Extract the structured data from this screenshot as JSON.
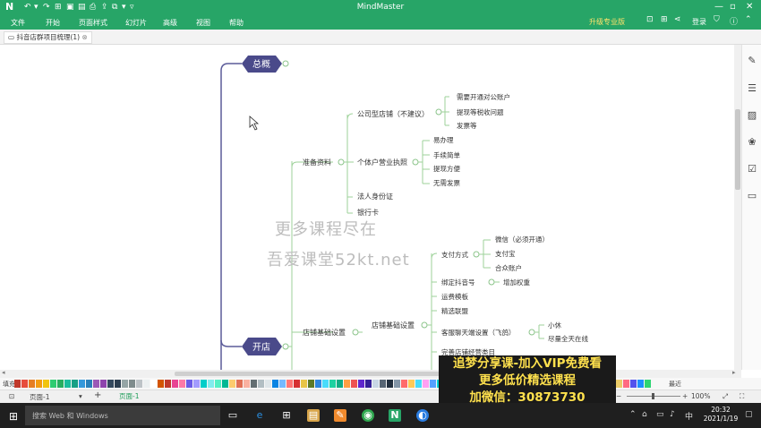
{
  "app": {
    "title": "MindMaster",
    "logo_glyph": "N",
    "pro_badge": "升级专业版",
    "login": "登录"
  },
  "menu": [
    "文件",
    "开始",
    "页面样式",
    "幻灯片",
    "高级",
    "视图",
    "帮助"
  ],
  "tabs": {
    "doc": "抖音店群项目梳理(1)",
    "close": "⊗"
  },
  "mindmap": {
    "topics": {
      "overview": "总概",
      "open": "开店"
    },
    "branch_prep": {
      "label": "准备资料",
      "company": "公司型店铺（不建议）",
      "company_children": [
        "需要开通对公账户",
        "提现等税收问题",
        "发票等"
      ],
      "individual": "个体户营业执照",
      "individual_children": [
        "易办理",
        "手续简单",
        "提现方便",
        "无需发票"
      ],
      "id_card": "法人身份证",
      "bank_card": "银行卡"
    },
    "branch_shop": {
      "label": "店铺基础设置",
      "sub": "店铺基础设置",
      "payment": "支付方式",
      "payment_children": [
        "微信（必须开通）",
        "支付宝",
        "合众账户"
      ],
      "bind": "绑定抖音号",
      "bind_child": "增加权重",
      "freight": "运费模板",
      "alliance": "精选联盟",
      "service": "客服聊天端设置（飞鸽）",
      "service_children": [
        "小休",
        "尽量全天在线"
      ],
      "improve": "完善店铺经营类目"
    }
  },
  "watermark": {
    "line1": "更多课程尽在",
    "line2": "吾爱课堂52kt.net"
  },
  "ad": {
    "line1": "追梦分享课-加入VIP免费看",
    "line2": "更多低价精选课程",
    "line3": "加微信：30873730"
  },
  "palette": {
    "fill_label": "填充",
    "recent_label": "最近"
  },
  "status": {
    "page_select": "页面-1",
    "page_tab": "页面-1",
    "add_page": "+",
    "zoom": "100%"
  },
  "taskbar": {
    "search_placeholder": "搜索 Web 和 Windows",
    "time": "20:32",
    "date": "2021/1/19",
    "ime": "中"
  },
  "colors": {
    "accent": "#27a567",
    "topic": "#4a4a8a",
    "branch_line": "#9ed29a",
    "main_line": "#5b5b99"
  }
}
